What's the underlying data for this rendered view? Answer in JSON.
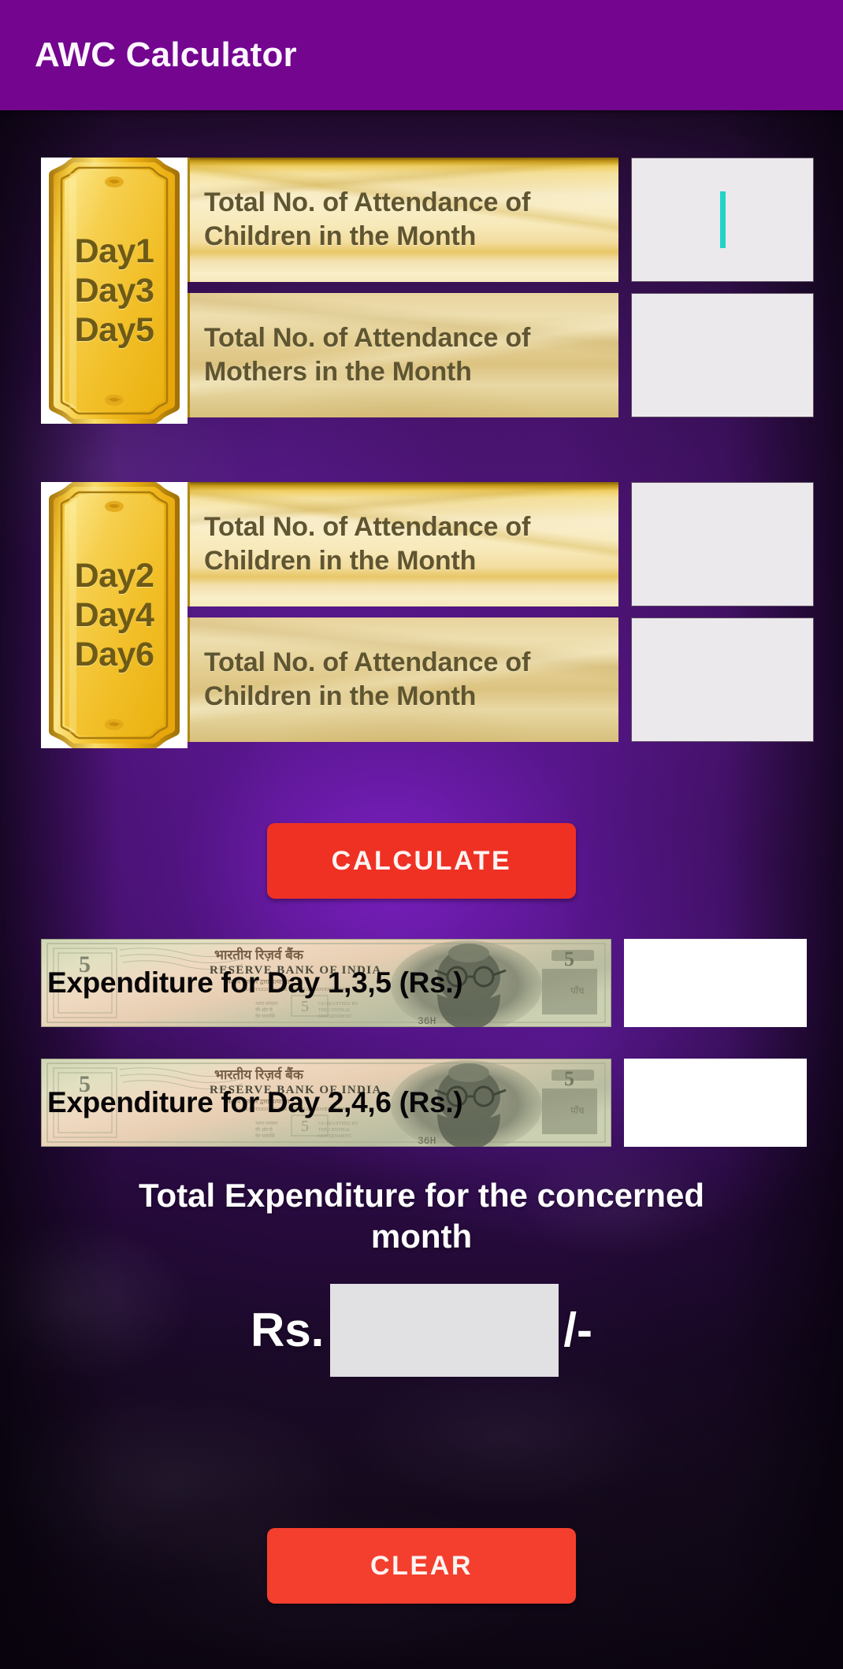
{
  "appbar": {
    "title": "AWC Calculator"
  },
  "theme": {
    "appbar_purple": "#73058F",
    "button_red": "#EF3124",
    "caret_cyan": "#23D3C6",
    "input_grey": "#EBE9EC",
    "input_white": "#FFFFFF",
    "total_input_grey": "#E1E0E3",
    "plaque_gold": "#F2B920",
    "banner_cream": "#F6E9BD",
    "banner_text": "#5F5531"
  },
  "cards": [
    {
      "plaque_days": [
        "Day1",
        "Day3",
        "Day5"
      ],
      "rows": [
        {
          "label": "Total No. of Attendance of Children in the Month",
          "value": "",
          "placeholder": "",
          "focused": true
        },
        {
          "label": "Total No. of Attendance of Mothers in the Month",
          "value": "",
          "placeholder": "",
          "focused": false
        }
      ]
    },
    {
      "plaque_days": [
        "Day2",
        "Day4",
        "Day6"
      ],
      "rows": [
        {
          "label": "Total No. of Attendance of Children in the Month",
          "value": "",
          "placeholder": "",
          "focused": false
        },
        {
          "label": "Total No. of Attendance of Children in the Month",
          "value": "",
          "placeholder": "",
          "focused": false
        }
      ]
    }
  ],
  "calculate_button": {
    "label": "CALCULATE"
  },
  "expenditure_rows": [
    {
      "label": "Expenditure for Day 1,3,5 (Rs.)",
      "value": "",
      "placeholder": "",
      "note_text": {
        "bank_hindi": "भारतीय रिज़र्व बैंक",
        "bank_english": "RESERVE BANK OF INDIA",
        "denomination": "5"
      }
    },
    {
      "label": "Expenditure for Day 2,4,6 (Rs.)",
      "value": "",
      "placeholder": "",
      "note_text": {
        "bank_hindi": "भारतीय रिज़र्व बैंक",
        "bank_english": "RESERVE BANK OF INDIA",
        "denomination": "5"
      }
    }
  ],
  "total": {
    "title": "Total Expenditure for the concerned month",
    "currency_prefix": "Rs.",
    "currency_suffix": "/-",
    "value": "",
    "placeholder": ""
  },
  "clear_button": {
    "label": "CLEAR"
  }
}
